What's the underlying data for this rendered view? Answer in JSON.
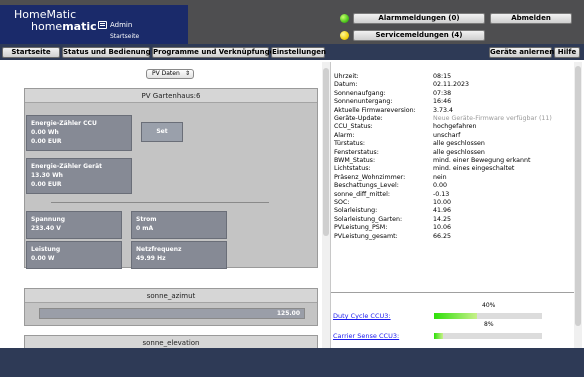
{
  "header": {
    "logo_top": "HomeMatic",
    "logo_bottom_plain": "home",
    "logo_bottom_bold": "matic",
    "user": "Admin",
    "page": "Startseite",
    "alarm_button": "Alarmmeldungen (0)",
    "service_button": "Servicemeldungen (4)",
    "logout_button": "Abmelden",
    "alarm_status_color": "#4ec61e",
    "service_status_color": "#f4d412"
  },
  "nav": {
    "items": [
      "Startseite",
      "Status und Bedienung",
      "Programme und Verknüpfungen",
      "Einstellungen"
    ],
    "teach_button": "Geräte anlernen",
    "help_button": "Hilfe"
  },
  "left": {
    "select_value": "PV Daten",
    "panel_title": "PV Gartenhaus:6",
    "energy_ccu": [
      "Energie-Zähler CCU",
      "0.00 Wh",
      "0.00 EUR"
    ],
    "set_button": "Set",
    "energy_device": [
      "Energie-Zähler Gerät",
      "13.30 Wh",
      "0.00 EUR"
    ],
    "voltage": [
      "Spannung",
      "233.40 V"
    ],
    "current": [
      "Strom",
      "0 mA"
    ],
    "power": [
      "Leistung",
      "0.00 W"
    ],
    "frequency": [
      "Netzfrequenz",
      "49.99 Hz"
    ],
    "azimut_title": "sonne_azimut",
    "azimut_value": "125.00",
    "azimut_fraction": 1.0,
    "elevation_title": "sonne_elevation"
  },
  "info": [
    {
      "k": "Uhrzeit:",
      "v": "08:15"
    },
    {
      "k": "Datum:",
      "v": "02.11.2023"
    },
    {
      "k": "Sonnenaufgang:",
      "v": "07:38"
    },
    {
      "k": "Sonnenuntergang:",
      "v": "16:46"
    },
    {
      "k": "Aktuelle Firmwareversion:",
      "v": "3.73.4"
    },
    {
      "k": "Geräte-Update:",
      "v": "Neue Geräte-Firmware verfügbar (11)",
      "grey": true
    },
    {
      "k": "CCU_Status:",
      "v": "hochgefahren"
    },
    {
      "k": "Alarm:",
      "v": "unscharf"
    },
    {
      "k": "Türstatus:",
      "v": "alle geschlossen"
    },
    {
      "k": "Fensterstatus:",
      "v": "alle geschlossen"
    },
    {
      "k": "BWM_Status:",
      "v": "mind. einer Bewegung erkannt"
    },
    {
      "k": "Lichtstatus:",
      "v": "mind. eines eingeschaltet"
    },
    {
      "k": "Präsenz_Wohnzimmer:",
      "v": "nein"
    },
    {
      "k": "Beschattungs_Level:",
      "v": "0.00"
    },
    {
      "k": "sonne_diff_mittel:",
      "v": "-0.13"
    },
    {
      "k": "SOC:",
      "v": "10.00"
    },
    {
      "k": "Solarleistung:",
      "v": "41.96"
    },
    {
      "k": "Solarleistung_Garten:",
      "v": "14.25"
    },
    {
      "k": "PVLeistung_PSM:",
      "v": "10.06"
    },
    {
      "k": "PVLeistung_gesamt:",
      "v": "66.25"
    }
  ],
  "usage": {
    "duty_label": "Duty Cycle CCU3:",
    "duty_pct_text": "40%",
    "duty_fraction": 0.4,
    "carrier_label": "Carrier Sense CCU3:",
    "carrier_pct_text": "8%",
    "carrier_fraction": 0.08
  }
}
